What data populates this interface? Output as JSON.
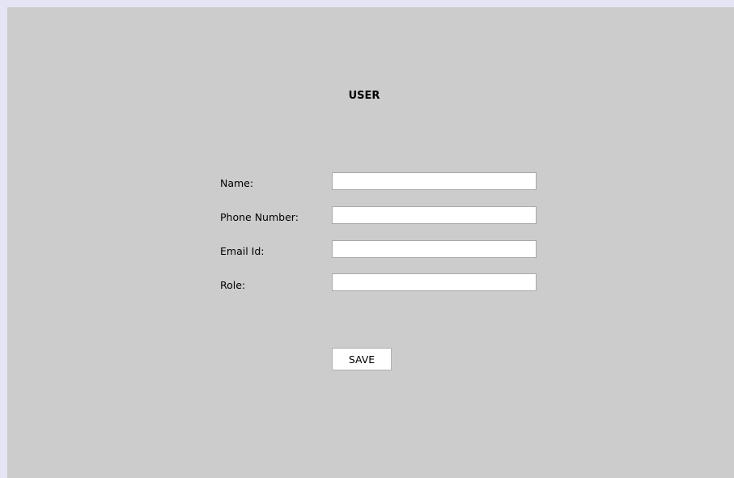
{
  "form": {
    "title": "USER",
    "fields": [
      {
        "label": "Name:",
        "value": "",
        "placeholder": ""
      },
      {
        "label": "Phone Number:",
        "value": "",
        "placeholder": ""
      },
      {
        "label": "Email Id:",
        "value": "",
        "placeholder": ""
      },
      {
        "label": "Role:",
        "value": "",
        "placeholder": ""
      }
    ],
    "save_label": "SAVE"
  },
  "colors": {
    "page_border": "#e4e4f4",
    "panel_background": "#cccccc",
    "input_background": "#ffffff",
    "input_border": "#a8a8a8"
  }
}
